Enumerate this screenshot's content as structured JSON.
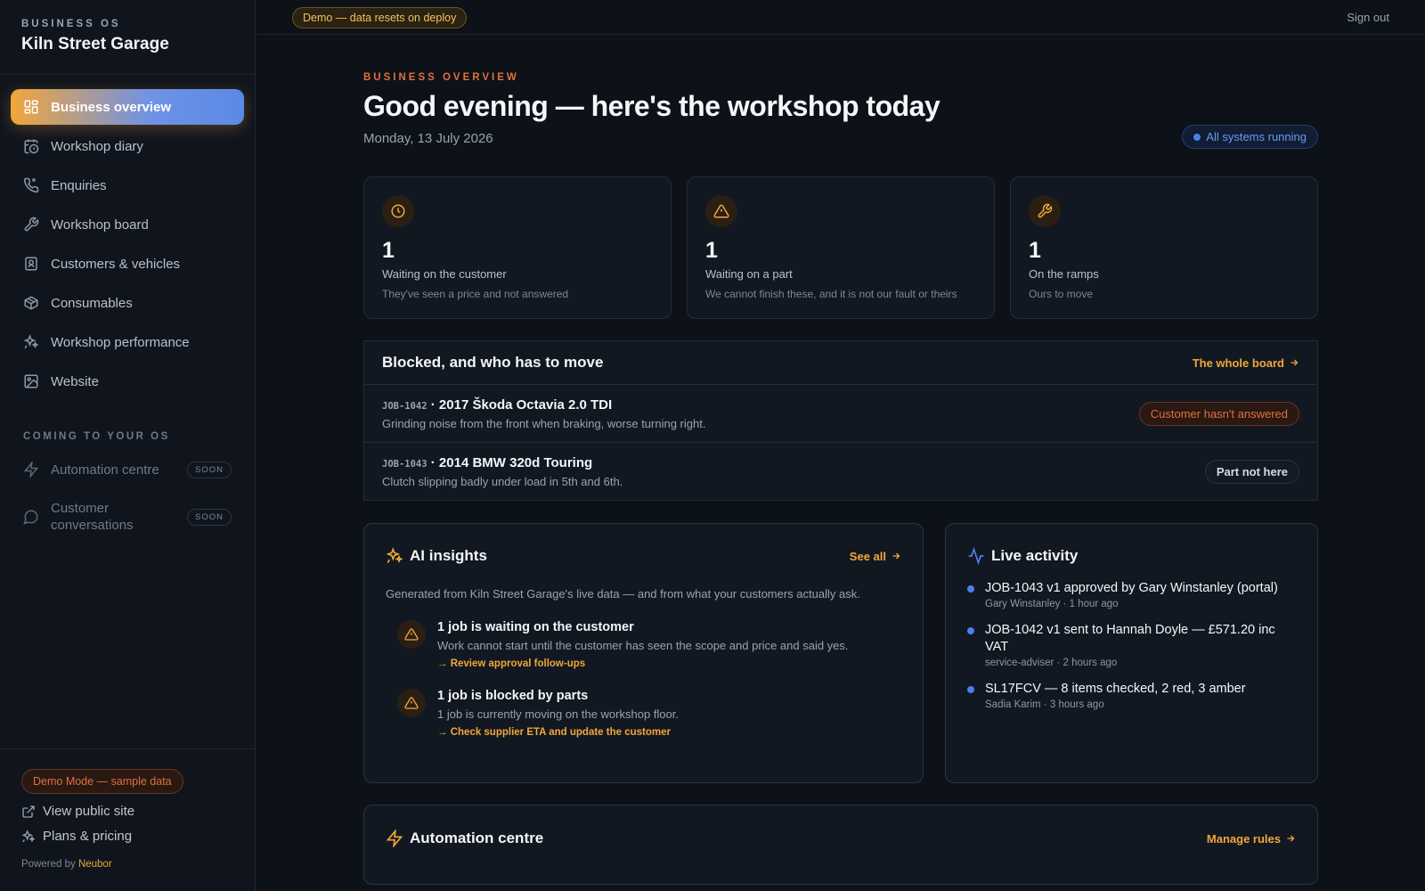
{
  "brand": {
    "kicker": "BUSINESS OS",
    "name": "Kiln Street Garage"
  },
  "nav": {
    "items": [
      {
        "label": "Business overview",
        "icon": "grid-icon",
        "active": true
      },
      {
        "label": "Workshop diary",
        "icon": "calendar-clock-icon"
      },
      {
        "label": "Enquiries",
        "icon": "phone-icon"
      },
      {
        "label": "Workshop board",
        "icon": "wrench-icon"
      },
      {
        "label": "Customers & vehicles",
        "icon": "id-badge-icon"
      },
      {
        "label": "Consumables",
        "icon": "box-icon"
      },
      {
        "label": "Workshop performance",
        "icon": "sparkles-icon"
      },
      {
        "label": "Website",
        "icon": "image-icon"
      }
    ],
    "section_label": "COMING TO YOUR OS",
    "soon_items": [
      {
        "label": "Automation centre",
        "badge": "SOON",
        "icon": "lightning-icon"
      },
      {
        "label": "Customer conversations",
        "badge": "SOON",
        "icon": "chat-bubble-icon"
      }
    ]
  },
  "sidebar_footer": {
    "demo_label": "Demo Mode — sample data",
    "view_site": "View public site",
    "plans": "Plans & pricing",
    "powered_prefix": "Powered by",
    "powered_brand": "Neubor"
  },
  "topbar": {
    "banner": "Demo — data resets on deploy",
    "signout": "Sign out"
  },
  "overview": {
    "kicker": "BUSINESS OVERVIEW",
    "headline": "Good evening — here's the workshop today",
    "date": "Monday, 13 July 2026",
    "status": "All systems running"
  },
  "stats": [
    {
      "value": "1",
      "label": "Waiting on the customer",
      "sub": "They've seen a price and not answered",
      "icon": "clock-icon"
    },
    {
      "value": "1",
      "label": "Waiting on a part",
      "sub": "We cannot finish these, and it is not our fault or theirs",
      "icon": "warning-icon"
    },
    {
      "value": "1",
      "label": "On the ramps",
      "sub": "Ours to move",
      "icon": "wrench-icon"
    }
  ],
  "blocked": {
    "title": "Blocked, and who has to move",
    "link": "The whole board",
    "rows": [
      {
        "id": "JOB-1042",
        "title": "· 2017 Škoda Octavia 2.0 TDI",
        "desc": "Grinding noise from the front when braking, worse turning right.",
        "tag": "Customer hasn't answered",
        "tone": "red"
      },
      {
        "id": "JOB-1043",
        "title": "· 2014 BMW 320d Touring",
        "desc": "Clutch slipping badly under load in 5th and 6th.",
        "tag": "Part not here",
        "tone": "neutral"
      }
    ]
  },
  "ai_insights": {
    "title": "AI insights",
    "link": "See all",
    "intro": "Generated from Kiln Street Garage's live data — and from what your customers actually ask.",
    "items": [
      {
        "title": "1 job is waiting on the customer",
        "body": "Work cannot start until the customer has seen the scope and price and said yes.",
        "action": "→ Review approval follow-ups"
      },
      {
        "title": "1 job is blocked by parts",
        "body": "1 job is currently moving on the workshop floor.",
        "action": "→ Check supplier ETA and update the customer"
      }
    ]
  },
  "live_activity": {
    "title": "Live activity",
    "items": [
      {
        "title": "JOB-1043 v1 approved by Gary Winstanley (portal)",
        "meta": "Gary Winstanley · 1 hour ago"
      },
      {
        "title": "JOB-1042 v1 sent to Hannah Doyle — £571.20 inc VAT",
        "meta": "service-adviser · 2 hours ago"
      },
      {
        "title": "SL17FCV — 8 items checked, 2 red, 3 amber",
        "meta": "Sadia Karim · 3 hours ago"
      }
    ]
  },
  "automation": {
    "title": "Automation centre",
    "link": "Manage rules"
  },
  "colors": {
    "accent": "#f2a63a",
    "danger": "#e0703d",
    "info": "#4b80ea",
    "background": "#0d1118"
  }
}
